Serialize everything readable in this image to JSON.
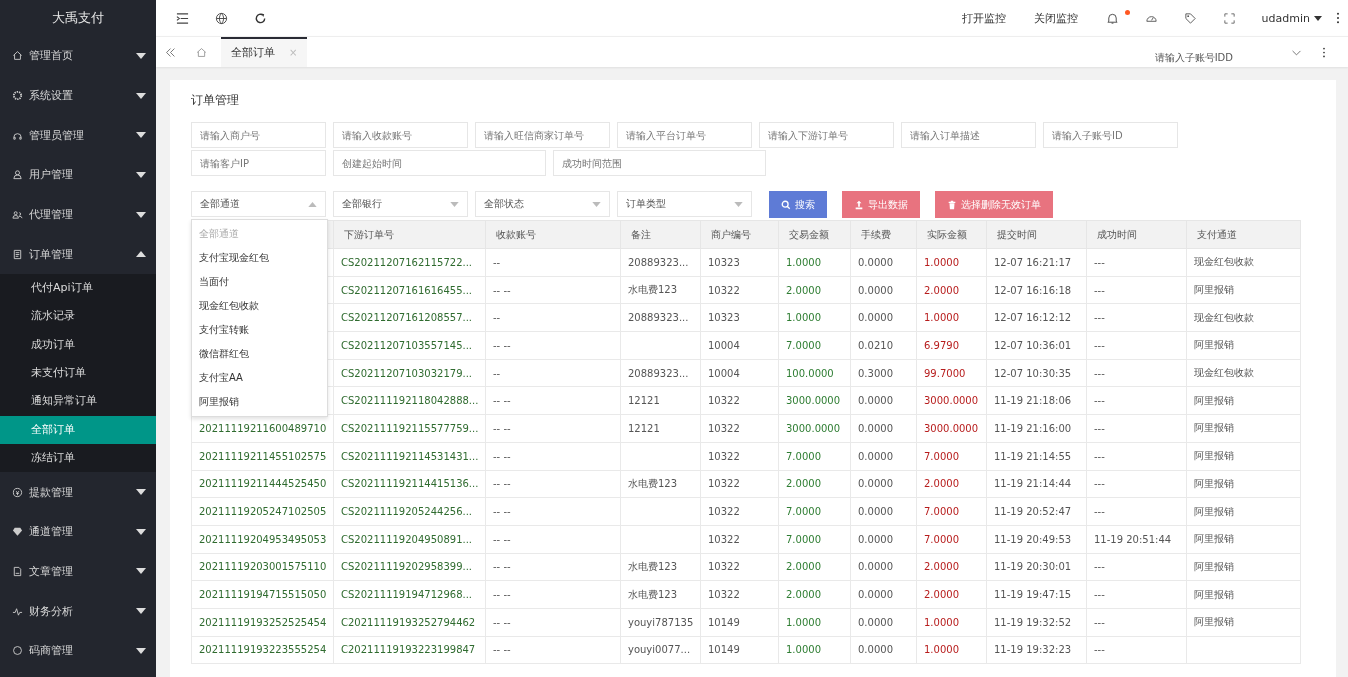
{
  "sidebar": {
    "logo": "大禹支付",
    "items": [
      {
        "label": "管理首页",
        "expanded": false
      },
      {
        "label": "系统设置",
        "expanded": false
      },
      {
        "label": "管理员管理",
        "expanded": false
      },
      {
        "label": "用户管理",
        "expanded": false
      },
      {
        "label": "代理管理",
        "expanded": false
      },
      {
        "label": "订单管理",
        "expanded": true,
        "children": [
          {
            "label": "代付Api订单",
            "selected": false
          },
          {
            "label": "流水记录",
            "selected": false
          },
          {
            "label": "成功订单",
            "selected": false
          },
          {
            "label": "未支付订单",
            "selected": false
          },
          {
            "label": "通知异常订单",
            "selected": false
          },
          {
            "label": "全部订单",
            "selected": true
          },
          {
            "label": "冻结订单",
            "selected": false
          }
        ]
      },
      {
        "label": "提款管理",
        "expanded": false
      },
      {
        "label": "通道管理",
        "expanded": false
      },
      {
        "label": "文章管理",
        "expanded": false
      },
      {
        "label": "财务分析",
        "expanded": false
      },
      {
        "label": "码商管理",
        "expanded": false
      }
    ]
  },
  "topbar": {
    "links": [
      "打开监控",
      "关闭监控"
    ],
    "notification_dot": true,
    "user": "udadmin"
  },
  "tabbar": {
    "tabs": [
      {
        "label": "全部订单",
        "selected": true,
        "close": "×"
      }
    ],
    "stray_text": "请输入子账号IDD"
  },
  "panel": {
    "title": "订单管理",
    "inputs": [
      {
        "placeholder": "请输入商户号"
      },
      {
        "placeholder": "请输入收款账号"
      },
      {
        "placeholder": "请输入旺信商家订单号"
      },
      {
        "placeholder": "请输入平台订单号"
      },
      {
        "placeholder": "请输入下游订单号"
      },
      {
        "placeholder": "请输入订单描述"
      },
      {
        "placeholder": "请输入子账号ID"
      }
    ],
    "inputs_row2": [
      {
        "placeholder": "请输客户IP"
      },
      {
        "placeholder": "创建起始时间"
      },
      {
        "placeholder": "成功时间范围"
      }
    ],
    "selects": [
      {
        "value": "全部通道",
        "open": true,
        "options": [
          {
            "label": "全部通道",
            "disabled": true
          },
          {
            "label": "支付宝现金红包",
            "disabled": false
          },
          {
            "label": "当面付",
            "disabled": false
          },
          {
            "label": "现金红包收款",
            "disabled": false
          },
          {
            "label": "支付宝转账",
            "disabled": false
          },
          {
            "label": "微信群红包",
            "disabled": false
          },
          {
            "label": "支付宝AA",
            "disabled": false
          },
          {
            "label": "阿里报销",
            "disabled": false
          }
        ]
      },
      {
        "value": "全部银行",
        "open": false
      },
      {
        "value": "全部状态",
        "open": false
      },
      {
        "value": "订单类型",
        "open": false
      }
    ],
    "buttons": [
      {
        "label": "搜索",
        "kind": "search"
      },
      {
        "label": "导出数据",
        "kind": "export"
      },
      {
        "label": "选择删除无效订单",
        "kind": "delete"
      }
    ],
    "table": {
      "columns": [
        {
          "label": "下游订单号",
          "kind": "order"
        },
        {
          "label": "收款账号",
          "kind": "text"
        },
        {
          "label": "备注",
          "kind": "text"
        },
        {
          "label": "商户编号",
          "kind": "text"
        },
        {
          "label": "交易金额",
          "kind": "amount"
        },
        {
          "label": "手续费",
          "kind": "text"
        },
        {
          "label": "实际金额",
          "kind": "actual"
        },
        {
          "label": "提交时间",
          "kind": "text"
        },
        {
          "label": "成功时间",
          "kind": "text"
        },
        {
          "label": "支付通道",
          "kind": "text"
        }
      ],
      "rows": [
        {
          "cells": [
            "CS20211207162115722...",
            "--",
            "20889323...",
            "10323",
            "1.0000",
            "0.0000",
            "1.0000",
            "12-07 16:21:17",
            "---",
            "现金红包收款"
          ]
        },
        {
          "cells": [
            "CS20211207161616455...",
            "-- --",
            "水电费123",
            "10322",
            "2.0000",
            "0.0000",
            "2.0000",
            "12-07 16:16:18",
            "---",
            "阿里报销"
          ]
        },
        {
          "cells": [
            "CS20211207161208557...",
            "--",
            "20889323...",
            "10323",
            "1.0000",
            "0.0000",
            "1.0000",
            "12-07 16:12:12",
            "---",
            "现金红包收款"
          ]
        },
        {
          "cells": [
            "CS20211207103557145...",
            "-- --",
            null,
            "10004",
            "7.0000",
            "0.0210",
            "6.9790",
            "12-07 10:36:01",
            "---",
            "阿里报销"
          ]
        },
        {
          "cells": [
            "CS20211207103032179...",
            "--",
            "20889323...",
            "10004",
            "100.0000",
            "0.3000",
            "99.7000",
            "12-07 10:30:35",
            "---",
            "现金红包收款"
          ]
        },
        {
          "cells": [
            "CS202111192118042888...",
            "-- --",
            "12121",
            "10322",
            "3000.0000",
            "0.0000",
            "3000.0000",
            "11-19 21:18:06",
            "---",
            "阿里报销"
          ]
        },
        {
          "order_no": "20211119211600489710",
          "cells": [
            "CS202111192115577759...",
            "-- --",
            "12121",
            "10322",
            "3000.0000",
            "0.0000",
            "3000.0000",
            "11-19 21:16:00",
            "---",
            "阿里报销"
          ]
        },
        {
          "order_no": "20211119211455102575",
          "cells": [
            "CS202111192114531431...",
            "-- --",
            null,
            "10322",
            "7.0000",
            "0.0000",
            "7.0000",
            "11-19 21:14:55",
            "---",
            "阿里报销"
          ]
        },
        {
          "order_no": "20211119211444525450",
          "cells": [
            "CS202111192114415136...",
            "-- --",
            "水电费123",
            "10322",
            "2.0000",
            "0.0000",
            "2.0000",
            "11-19 21:14:44",
            "---",
            "阿里报销"
          ]
        },
        {
          "order_no": "20211119205247102505",
          "cells": [
            "CS20211119205244256...",
            "-- --",
            null,
            "10322",
            "7.0000",
            "0.0000",
            "7.0000",
            "11-19 20:52:47",
            "---",
            "阿里报销"
          ]
        },
        {
          "order_no": "20211119204953495053",
          "cells": [
            "CS20211119204950891...",
            "-- --",
            null,
            "10322",
            "7.0000",
            "0.0000",
            "7.0000",
            "11-19 20:49:53",
            "11-19 20:51:44",
            "阿里报销"
          ]
        },
        {
          "order_no": "20211119203001575110",
          "cells": [
            "CS20211119202958399...",
            "-- --",
            "水电费123",
            "10322",
            "2.0000",
            "0.0000",
            "2.0000",
            "11-19 20:30:01",
            "---",
            "阿里报销"
          ]
        },
        {
          "order_no": "20211119194715515050",
          "cells": [
            "CS20211119194712968...",
            "-- --",
            "水电费123",
            "10322",
            "2.0000",
            "0.0000",
            "2.0000",
            "11-19 19:47:15",
            "---",
            "阿里报销"
          ]
        },
        {
          "order_no": "20211119193252525454",
          "cells": [
            "C20211119193252794462",
            "-- --",
            "youyi787135",
            "10149",
            "1.0000",
            "0.0000",
            "1.0000",
            "11-19 19:32:52",
            "---",
            "阿里报销"
          ]
        },
        {
          "order_no": "20211119193223555254",
          "cells": [
            "C20211119193223199847",
            "-- --",
            "youyi0077...",
            "10149",
            "1.0000",
            "0.0000",
            "1.0000",
            "11-19 19:32:23",
            "---",
            null
          ]
        }
      ]
    }
  }
}
